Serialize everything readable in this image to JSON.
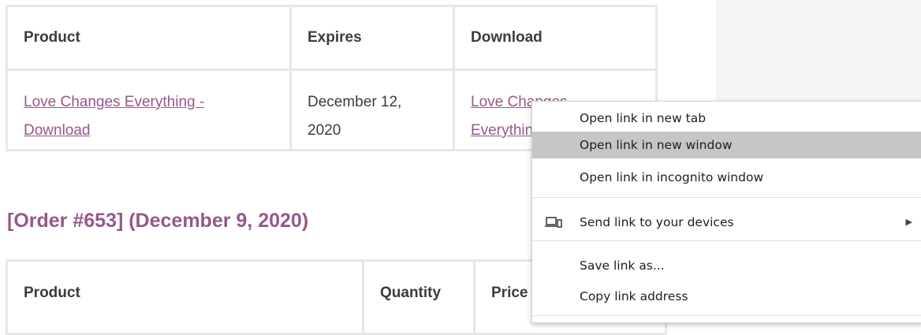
{
  "downloads_table": {
    "headers": [
      "Product",
      "Expires",
      "Download"
    ],
    "row": {
      "product": "Love Changes Everything - Download",
      "expires": "December 12, 2020",
      "download": "Love Changes Everything"
    }
  },
  "order": {
    "heading": "[Order #653] (December 9, 2020)",
    "table_headers": [
      "Product",
      "Quantity",
      "Price"
    ]
  },
  "context_menu": {
    "items": {
      "open_new_tab": "Open link in new tab",
      "open_new_window": "Open link in new window",
      "open_incognito": "Open link in incognito window",
      "send_to_devices": "Send link to your devices",
      "save_link_as": "Save link as...",
      "copy_link_address": "Copy link address"
    },
    "highlighted": "open_new_window"
  },
  "colors": {
    "accent": "#96588a",
    "menu_highlight": "#c6c6c6",
    "border": "#e8e8e8"
  }
}
